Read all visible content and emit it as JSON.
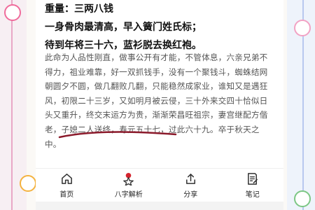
{
  "poem": [
    "重量：三两八钱",
    "一身骨肉最清高，早入簧门姓氏标；",
    "待到年将三十六，蓝衫脱去换红袍。"
  ],
  "prose": {
    "main": "此命为人品性刚直，做事公开有才能，不管体息，六亲兄弟不得力，祖业难靠，好一双抓钱手，没有一个聚钱斗，蜘蛛结网朝圆夕不圆，做几翻败几翻，只能稳然成家业，谁知又是遇狂风，初限二十三岁，又如明月被云侵，三十外来交四十恰似日头又重升，终交末运方为贵，渐渐荣昌旺祖宗，妻宫继配方偕老，子媳二人送终，",
    "highlight": "寿元五十七，过此六十九。",
    "tail": "卒于秋天之中。"
  },
  "tabs": [
    {
      "label": "首页",
      "icon": "home-icon"
    },
    {
      "label": "八字解析",
      "icon": "star-badge-icon"
    },
    {
      "label": "分享",
      "icon": "share-icon"
    },
    {
      "label": "笔记",
      "icon": "note-icon"
    }
  ],
  "colors": {
    "accent_underline": "#8b1a2b",
    "text_dark": "#111111",
    "text_body": "#555555",
    "badge_red": "#d4242e"
  }
}
